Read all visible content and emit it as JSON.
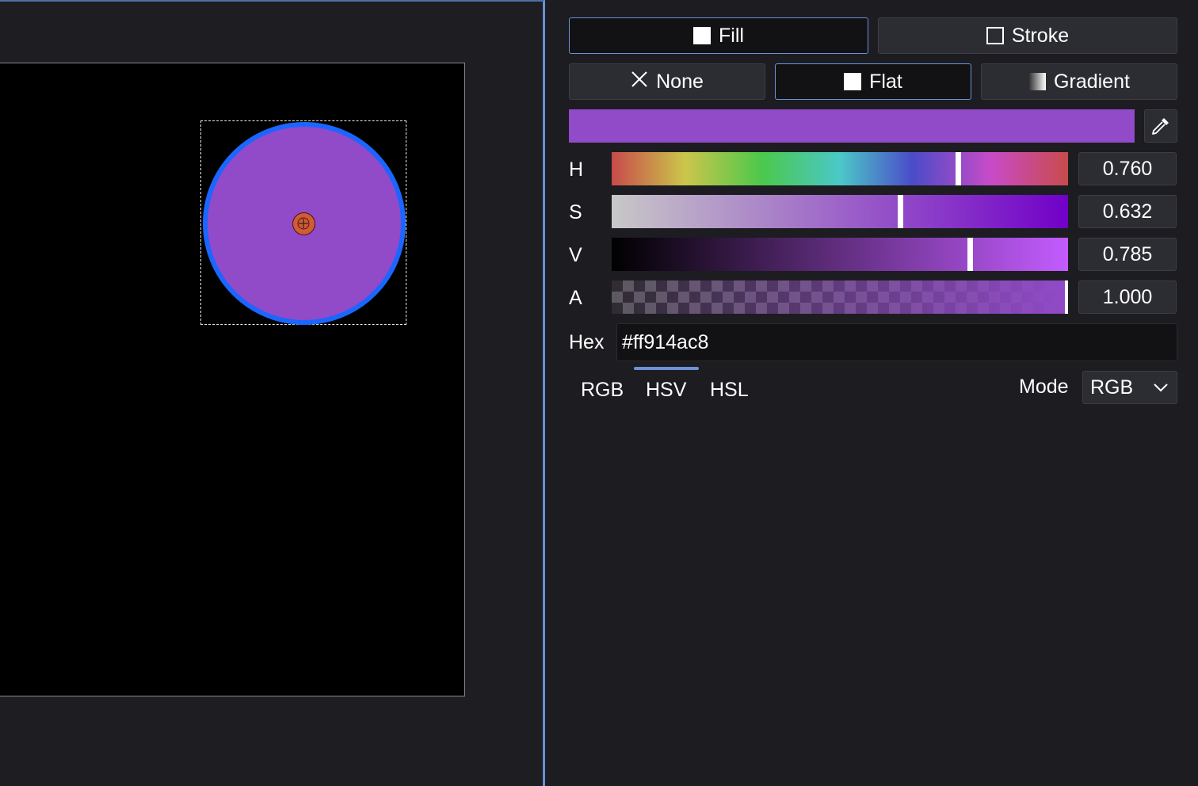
{
  "colors": {
    "accent": "#6b93d6",
    "current_fill": "#914ac8",
    "shape_stroke": "#1a66ff",
    "center_handle": "#d35a35"
  },
  "paint_target": {
    "fill_label": "Fill",
    "stroke_label": "Stroke",
    "selected": "Fill"
  },
  "paint_type": {
    "none_label": "None",
    "flat_label": "Flat",
    "gradient_label": "Gradient",
    "selected": "Flat"
  },
  "sliders": [
    {
      "label": "H",
      "value": "0.760",
      "fraction": 0.76
    },
    {
      "label": "S",
      "value": "0.632",
      "fraction": 0.632
    },
    {
      "label": "V",
      "value": "0.785",
      "fraction": 0.785
    },
    {
      "label": "A",
      "value": "1.000",
      "fraction": 1.0
    }
  ],
  "hex": {
    "label": "Hex",
    "value": "#ff914ac8"
  },
  "tabs": {
    "rgb": "RGB",
    "hsv": "HSV",
    "hsl": "HSL",
    "selected": "HSV"
  },
  "mode": {
    "label": "Mode",
    "value": "RGB"
  },
  "icons": {
    "eyedropper": "eyedropper-icon",
    "none": "x-icon",
    "dropdown": "chevron-down-icon",
    "center": "crosshair-icon"
  }
}
